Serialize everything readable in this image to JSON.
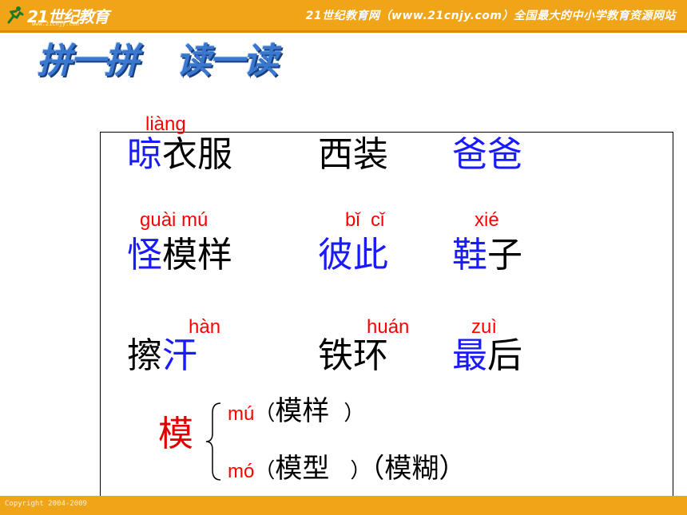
{
  "header": {
    "logo_text": "21世纪教育",
    "logo_url": "www.21cnjy.com",
    "slogan": "21世纪教育网（www.21cnjy.com）全国最大的中小学教育资源网站"
  },
  "footer": {
    "copyright": "Copyright 2004-2009"
  },
  "title": {
    "part1": "拼一拼",
    "part2": "读一读"
  },
  "rows": [
    {
      "items": [
        {
          "pinyin": "liàng",
          "blue": "晾",
          "black": "衣服"
        },
        {
          "pinyin": "",
          "blue": "",
          "black": "西装"
        },
        {
          "pinyin": "",
          "blue": "爸爸",
          "black": ""
        }
      ]
    },
    {
      "items": [
        {
          "pinyin": "guài mú",
          "blue": "怪",
          "black": "模样"
        },
        {
          "pinyin": "bǐ  cǐ",
          "blue": "彼此",
          "black": ""
        },
        {
          "pinyin": "xié",
          "blue": "鞋",
          "black": "子"
        }
      ]
    },
    {
      "items": [
        {
          "pinyin": "hàn",
          "black_first": "擦",
          "blue": "汗"
        },
        {
          "pinyin": "huán",
          "black": "铁环"
        },
        {
          "pinyin": "zuì",
          "blue": "最",
          "black": "后"
        }
      ]
    }
  ],
  "polyphone": {
    "char": "模",
    "reading1": {
      "pinyin": "mú",
      "open": "（",
      "word": "模样",
      "close": "）"
    },
    "reading2": {
      "pinyin": "mó",
      "open": "（",
      "word": "模型",
      "close": "）",
      "extra": "（模糊）"
    }
  },
  "colors": {
    "header": "#f0a418",
    "pinyin": "#ff0000",
    "highlight": "#1a1aff",
    "title": "#3a78d0"
  }
}
